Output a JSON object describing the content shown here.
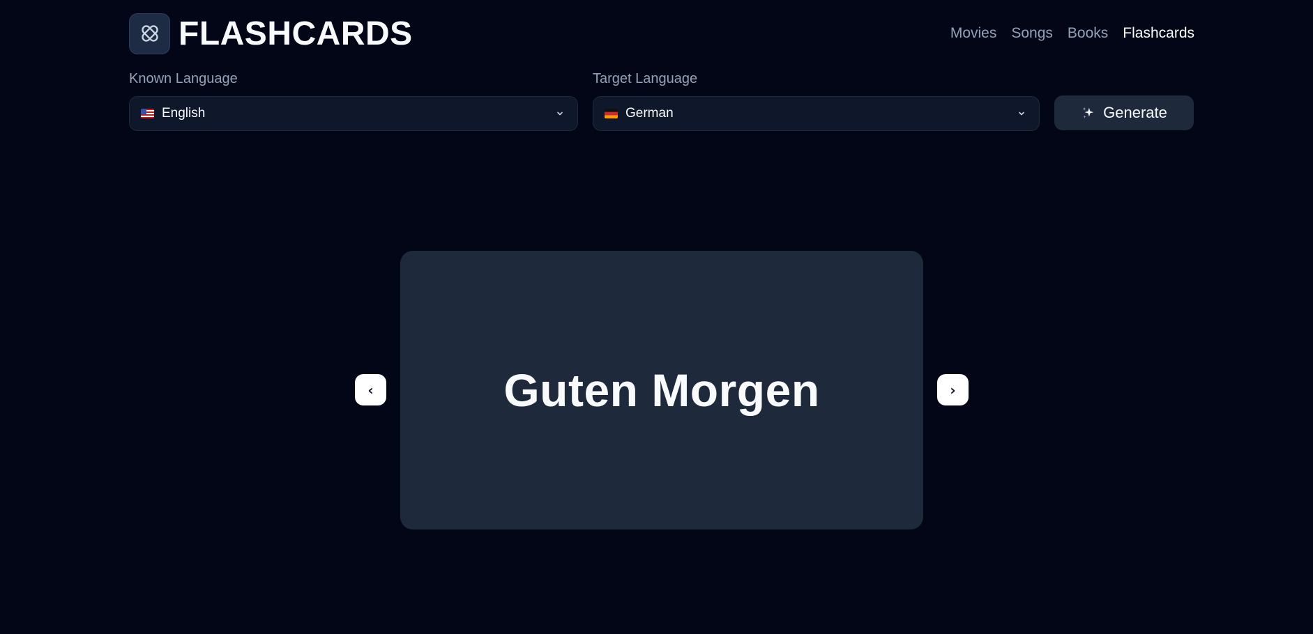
{
  "app": {
    "title": "FLASHCARDS",
    "logo_icon": "bandage-icon"
  },
  "nav": {
    "items": [
      {
        "label": "Movies",
        "active": false
      },
      {
        "label": "Songs",
        "active": false
      },
      {
        "label": "Books",
        "active": false
      },
      {
        "label": "Flashcards",
        "active": true
      }
    ]
  },
  "known_language": {
    "label": "Known Language",
    "value": "English",
    "flag": "us-flag-icon"
  },
  "target_language": {
    "label": "Target Language",
    "value": "German",
    "flag": "de-flag-icon"
  },
  "generate": {
    "label": "Generate",
    "icon": "sparkles-icon"
  },
  "card": {
    "text": "Guten Morgen"
  },
  "arrows": {
    "prev": "‹",
    "next": "›"
  },
  "colors": {
    "background": "#030617",
    "card": "#1e293b",
    "select_bg": "#0f172a",
    "muted_text": "#94a3b8",
    "text": "#f8fafc"
  }
}
